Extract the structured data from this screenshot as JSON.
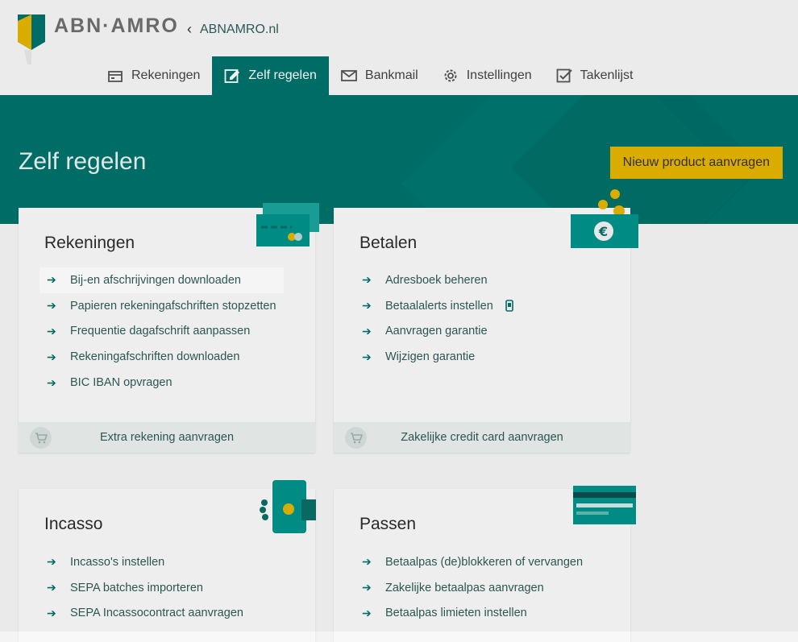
{
  "brand": {
    "name": "ABN·AMRO"
  },
  "header": {
    "back_label": "ABNAMRO.nl"
  },
  "nav": [
    {
      "label": "Rekeningen",
      "icon": "wallet-icon"
    },
    {
      "label": "Zelf regelen",
      "icon": "edit-icon",
      "active": true
    },
    {
      "label": "Bankmail",
      "icon": "mail-icon"
    },
    {
      "label": "Instellingen",
      "icon": "gear-icon"
    },
    {
      "label": "Takenlijst",
      "icon": "checkbox-icon"
    }
  ],
  "hero": {
    "title": "Zelf regelen",
    "cta": "Nieuw product aanvragen"
  },
  "cards": {
    "rekeningen": {
      "title": "Rekeningen",
      "items": [
        "Bij-en afschrijvingen downloaden",
        "Papieren rekeningafschriften stopzetten",
        "Frequentie dagafschrift aanpassen",
        "Rekeningafschriften downloaden",
        "BIC IBAN opvragen"
      ],
      "footer": "Extra rekening aanvragen"
    },
    "betalen": {
      "title": "Betalen",
      "items": [
        "Adresboek beheren",
        "Betaalalerts instellen",
        "Aanvragen garantie",
        "Wijzigen garantie"
      ],
      "footer": "Zakelijke credit card aanvragen"
    },
    "incasso": {
      "title": "Incasso",
      "items": [
        "Incasso's instellen",
        "SEPA batches importeren",
        "SEPA Incassocontract aanvragen"
      ]
    },
    "passen": {
      "title": "Passen",
      "items": [
        "Betaalpas (de)blokkeren of vervangen",
        "Zakelijke betaalpas aanvragen",
        "Betaalpas limieten instellen"
      ]
    }
  },
  "colors": {
    "brand_green": "#00716b",
    "accent_yellow": "#e3b400"
  }
}
